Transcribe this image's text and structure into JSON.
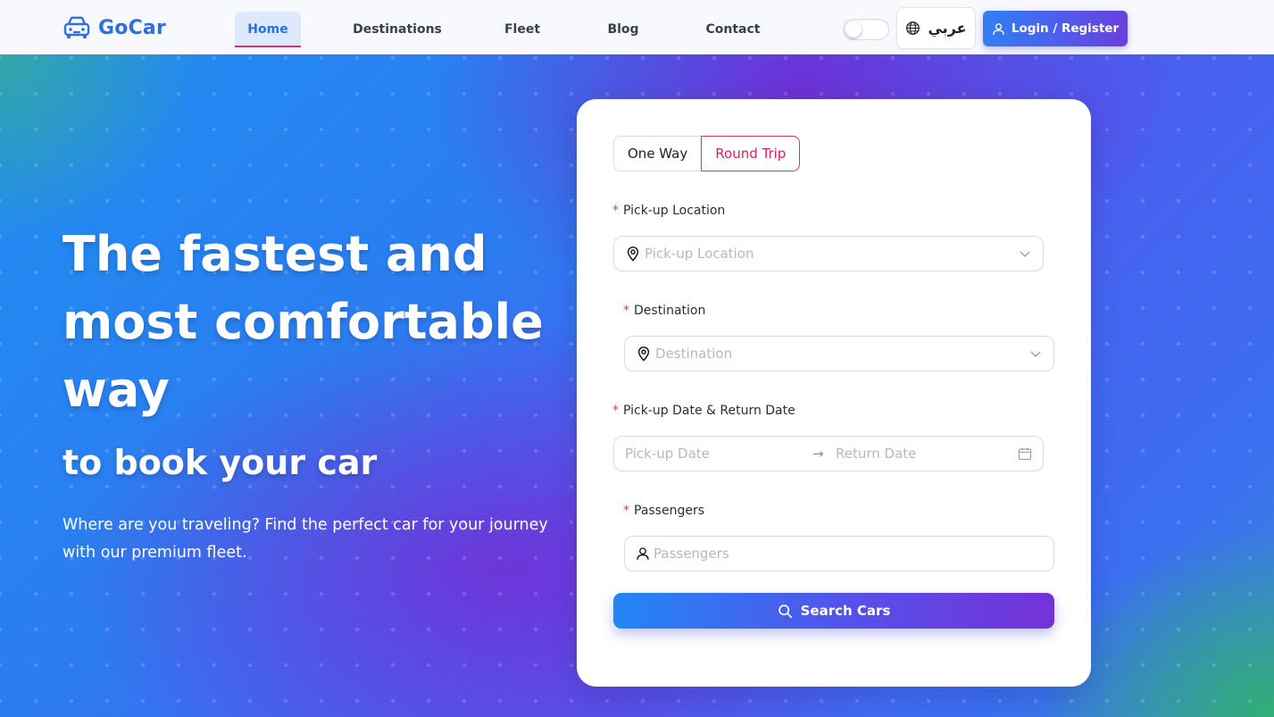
{
  "header": {
    "brand": "GoCar",
    "nav": [
      {
        "label": "Home",
        "active": true
      },
      {
        "label": "Destinations",
        "active": false
      },
      {
        "label": "Fleet",
        "active": false
      },
      {
        "label": "Blog",
        "active": false
      },
      {
        "label": "Contact",
        "active": false
      }
    ],
    "theme_toggle_on": false,
    "language_label": "عربي",
    "login_label": "Login / Register"
  },
  "hero": {
    "title": "The fastest and most comfortable way",
    "subtitle": "to book your car",
    "description": "Where are you traveling? Find the perfect car for your journey with our premium fleet."
  },
  "booking": {
    "trip_types": [
      {
        "label": "One Way",
        "selected": false
      },
      {
        "label": "Round Trip",
        "selected": true
      }
    ],
    "required_mark": "*",
    "pickup": {
      "label": "Pick-up Location",
      "placeholder": "Pick-up Location"
    },
    "destination": {
      "label": "Destination",
      "placeholder": "Destination"
    },
    "dates": {
      "label": "Pick-up Date & Return Date",
      "start_placeholder": "Pick-up Date",
      "separator": "→",
      "end_placeholder": "Return Date"
    },
    "passengers": {
      "label": "Passengers",
      "placeholder": "Passengers"
    },
    "submit_label": "Search Cars"
  },
  "icons": {
    "logo": "car-icon",
    "language": "globe-icon",
    "login": "user-icon",
    "location": "map-pin-icon",
    "dropdown": "chevron-down-icon",
    "calendar": "calendar-icon",
    "passengers": "user-icon",
    "search": "search-icon"
  },
  "colors": {
    "brand": "#2f6fe6",
    "accent_pink": "#d8316c",
    "required": "#e8344e",
    "button_start": "#2286f5",
    "button_end": "#7532d6"
  }
}
